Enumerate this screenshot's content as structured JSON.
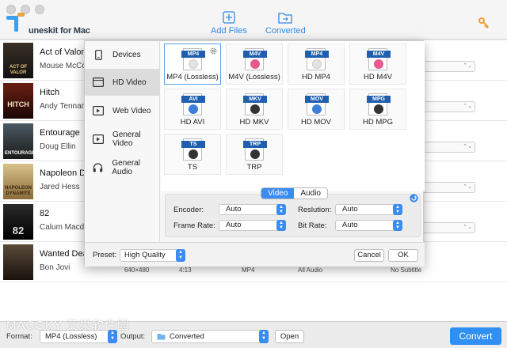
{
  "app": {
    "brand": "uneskit for Mac"
  },
  "toolbar": {
    "add_files": "Add Files",
    "converted": "Converted",
    "accent": "#2f8be6"
  },
  "movies": [
    {
      "title": "Act of Valor",
      "sub": "Mouse McCoy",
      "poster_text": "ACT OF VALOR"
    },
    {
      "title": "Hitch",
      "sub": "Andy Tennant",
      "poster_text": "HITCH"
    },
    {
      "title": "Entourage",
      "sub": "Doug Ellin",
      "poster_text": "ENTOURAGE"
    },
    {
      "title": "Napoleon Dyn",
      "sub": "Jared Hess",
      "poster_text": "NAPOLEON DYNAMITE"
    },
    {
      "title": "82",
      "sub": "Calum Macdia",
      "poster_text": "82"
    },
    {
      "title": "Wanted Dead",
      "sub": "Bon Jovi",
      "poster_text": ""
    }
  ],
  "last_row_info": {
    "resolution": "640×480",
    "duration": "4:13",
    "format": "MP4",
    "audio": "All Audio",
    "subtitle": "No Subtitle"
  },
  "categories": [
    {
      "label": "Devices",
      "icon": "phone-icon"
    },
    {
      "label": "HD Video",
      "icon": "hd-video-icon",
      "active": true
    },
    {
      "label": "Web Video",
      "icon": "web-video-icon"
    },
    {
      "label": "General Video",
      "icon": "film-icon"
    },
    {
      "label": "General Audio",
      "icon": "headphones-icon"
    }
  ],
  "formats": [
    {
      "badge": "MP4",
      "label": "MP4 (Lossless)",
      "selected": true,
      "emblem": "#e3e3e3"
    },
    {
      "badge": "M4V",
      "label": "M4V (Lossless)",
      "emblem": "#e85a8f"
    },
    {
      "badge": "MP4",
      "label": "HD MP4",
      "emblem": "#e3e3e3"
    },
    {
      "badge": "M4V",
      "label": "HD M4V",
      "emblem": "#e85a8f"
    },
    {
      "badge": "AVI",
      "label": "HD AVI",
      "emblem": "#3b7fd8"
    },
    {
      "badge": "MKV",
      "label": "HD MKV",
      "emblem": "#333333"
    },
    {
      "badge": "MOV",
      "label": "HD MOV",
      "emblem": "#3b7fd8"
    },
    {
      "badge": "MPG",
      "label": "HD MPG",
      "emblem": "#333333"
    },
    {
      "badge": "TS",
      "label": "TS",
      "emblem": "#333333"
    },
    {
      "badge": "TRP",
      "label": "TRP",
      "emblem": "#333333"
    }
  ],
  "settings": {
    "tab_video": "Video",
    "tab_audio": "Audio",
    "encoder_label": "Encoder:",
    "encoder_value": "Auto",
    "resolution_label": "Reslution:",
    "resolution_value": "Auto",
    "framerate_label": "Frame Rate:",
    "framerate_value": "Auto",
    "bitrate_label": "Bit Rate:",
    "bitrate_value": "Auto"
  },
  "popup_footer": {
    "preset_label": "Preset:",
    "preset_value": "High Quality",
    "cancel": "Cancel",
    "ok": "OK"
  },
  "bottom": {
    "format_label": "Format:",
    "format_value": "MP4 (Lossless)",
    "output_label": "Output:",
    "output_value": "Converted",
    "open": "Open",
    "convert": "Convert",
    "convert_color": "#2f8ff2"
  },
  "watermark": "MACGKY 艾果软件园"
}
